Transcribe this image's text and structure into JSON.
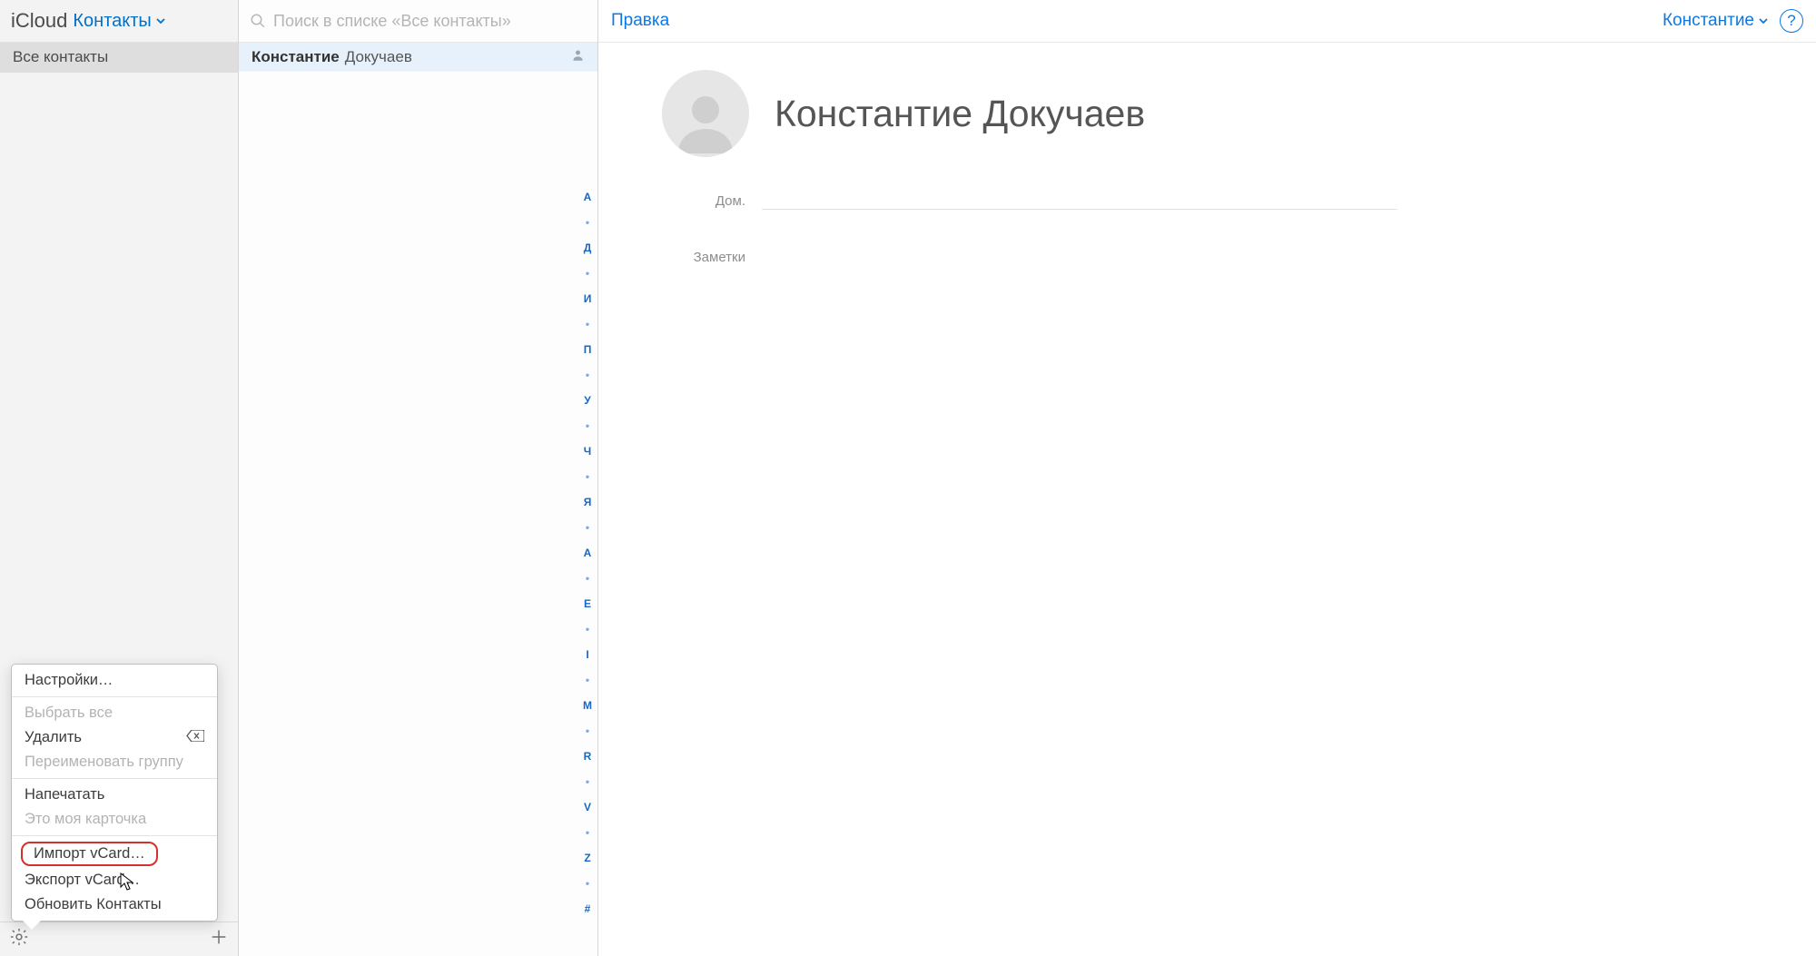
{
  "header": {
    "brand": "iCloud",
    "app_name": "Контакты"
  },
  "sidebar": {
    "groups": [
      {
        "label": "Все контакты"
      }
    ]
  },
  "search": {
    "placeholder": "Поиск в списке «Все контакты»"
  },
  "contacts": [
    {
      "first": "Константие",
      "last": "Докучаев",
      "is_me": true
    }
  ],
  "alpha_index": [
    "А",
    "•",
    "Д",
    "•",
    "И",
    "•",
    "П",
    "•",
    "У",
    "•",
    "Ч",
    "•",
    "Я",
    "•",
    "A",
    "•",
    "E",
    "•",
    "I",
    "•",
    "M",
    "•",
    "R",
    "•",
    "V",
    "•",
    "Z",
    "•",
    "#"
  ],
  "detail": {
    "edit_label": "Правка",
    "user_label": "Константие",
    "full_name": "Константие Докучаев",
    "fields": {
      "home_label": "Дом.",
      "notes_label": "Заметки"
    }
  },
  "gear_menu": {
    "preferences": "Настройки…",
    "select_all": "Выбрать все",
    "delete": "Удалить",
    "rename_group": "Переименовать группу",
    "print": "Напечатать",
    "this_is_my_card": "Это моя карточка",
    "import_vcard": "Импорт vCard…",
    "export_vcard": "Экспорт vCard…",
    "refresh": "Обновить Контакты"
  }
}
